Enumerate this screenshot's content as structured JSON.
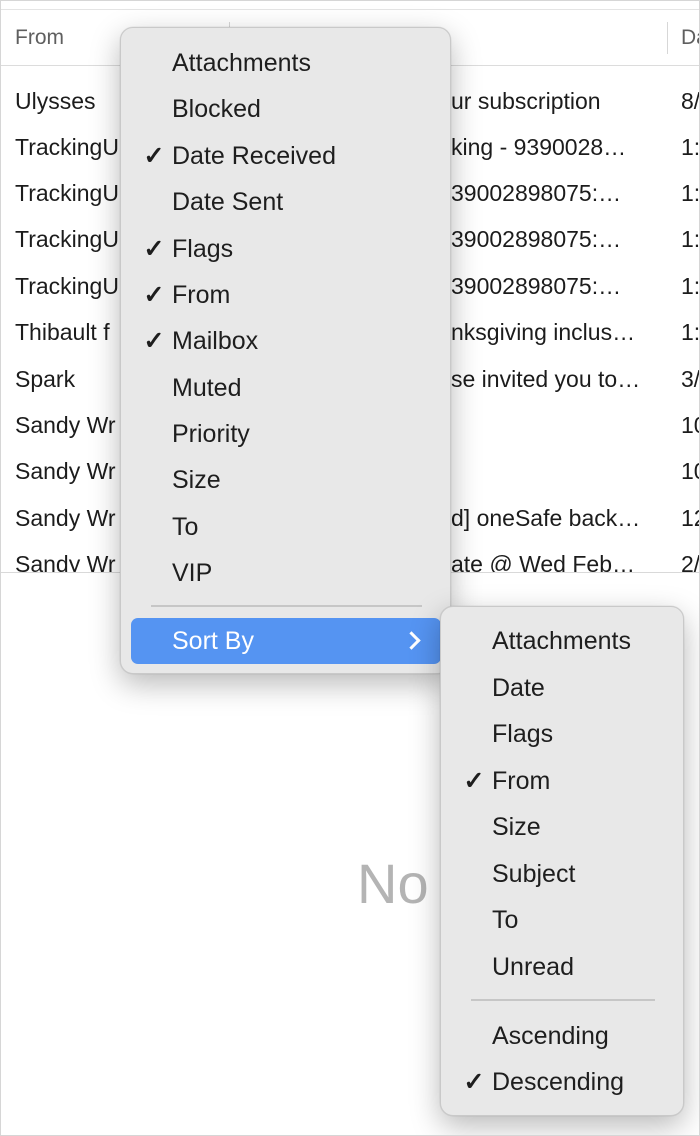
{
  "list": {
    "headers": {
      "from": "From",
      "date": "Da"
    },
    "rows": [
      {
        "from": "Ulysses",
        "subject": "ur subscription",
        "date": "8/"
      },
      {
        "from": "TrackingU",
        "subject": "king - 9390028…",
        "date": "1:"
      },
      {
        "from": "TrackingU",
        "subject": "39002898075:…",
        "date": "1:"
      },
      {
        "from": "TrackingU",
        "subject": "39002898075:…",
        "date": "1:"
      },
      {
        "from": "TrackingU",
        "subject": "39002898075:…",
        "date": "1:"
      },
      {
        "from": "Thibault f",
        "subject": "nksgiving inclus…",
        "date": "1:"
      },
      {
        "from": "Spark",
        "subject": "se invited you to…",
        "date": "3/"
      },
      {
        "from": "Sandy Wr",
        "subject": "",
        "date": "10"
      },
      {
        "from": "Sandy Wr",
        "subject": "",
        "date": "10"
      },
      {
        "from": "Sandy Wr",
        "subject": "d] oneSafe back…",
        "date": "12"
      },
      {
        "from": "Sandy Wr",
        "subject": "ate @ Wed Feb…",
        "date": "2/"
      }
    ]
  },
  "preview": {
    "empty_text": "No"
  },
  "columns_menu": {
    "items": [
      {
        "label": "Attachments",
        "checked": false
      },
      {
        "label": "Blocked",
        "checked": false
      },
      {
        "label": "Date Received",
        "checked": true
      },
      {
        "label": "Date Sent",
        "checked": false
      },
      {
        "label": "Flags",
        "checked": true
      },
      {
        "label": "From",
        "checked": true
      },
      {
        "label": "Mailbox",
        "checked": true
      },
      {
        "label": "Muted",
        "checked": false
      },
      {
        "label": "Priority",
        "checked": false
      },
      {
        "label": "Size",
        "checked": false
      },
      {
        "label": "To",
        "checked": false
      },
      {
        "label": "VIP",
        "checked": false
      }
    ],
    "submenu_label": "Sort By",
    "check_glyph": "✓"
  },
  "sort_menu": {
    "fields": [
      {
        "label": "Attachments",
        "checked": false
      },
      {
        "label": "Date",
        "checked": false
      },
      {
        "label": "Flags",
        "checked": false
      },
      {
        "label": "From",
        "checked": true
      },
      {
        "label": "Size",
        "checked": false
      },
      {
        "label": "Subject",
        "checked": false
      },
      {
        "label": "To",
        "checked": false
      },
      {
        "label": "Unread",
        "checked": false
      }
    ],
    "order": [
      {
        "label": "Ascending",
        "checked": false
      },
      {
        "label": "Descending",
        "checked": true
      }
    ]
  },
  "colors": {
    "highlight": "#5594f2",
    "menu_bg": "#e8e8e8",
    "placeholder_text": "#b4b4b4"
  }
}
